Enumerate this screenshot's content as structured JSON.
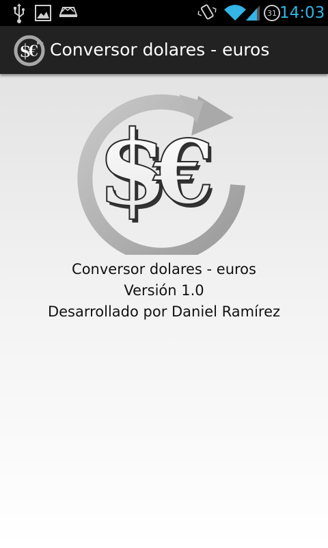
{
  "status_bar": {
    "time": "14:03",
    "calendar_day": "31",
    "icons": [
      "usb-icon",
      "gallery-icon",
      "notification-icon",
      "vibrate-icon",
      "wifi-icon",
      "signal-icon",
      "calendar-icon"
    ],
    "clock_color": "#33b5e5"
  },
  "action_bar": {
    "title": "Conversor dolares - euros",
    "icon": "dollar-euro-app-icon",
    "background": "#222222"
  },
  "about": {
    "logo": "dollar-euro-logo",
    "app_name": "Conversor dolares - euros",
    "version": "Versión 1.0",
    "author": "Desarrollado por Daniel Ramírez",
    "logo_symbols": "$€"
  }
}
